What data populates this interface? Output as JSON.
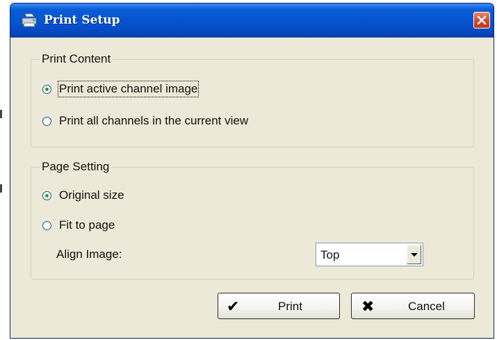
{
  "window": {
    "title": "Print Setup",
    "icon": "printer-icon",
    "close_icon": "close-icon"
  },
  "print_content": {
    "legend": "Print Content",
    "options": [
      {
        "label": "Print active channel image",
        "checked": true
      },
      {
        "label": "Print all channels in the current view",
        "checked": false
      }
    ]
  },
  "page_setting": {
    "legend": "Page Setting",
    "options": [
      {
        "label": "Original size",
        "checked": true
      },
      {
        "label": "Fit to page",
        "checked": false
      }
    ],
    "align_label": "Align Image:",
    "align_value": "Top"
  },
  "buttons": {
    "print": {
      "label": "Print",
      "icon": "checkmark-icon",
      "glyph": "✔"
    },
    "cancel": {
      "label": "Cancel",
      "icon": "cross-icon",
      "glyph": "✖"
    }
  },
  "colors": {
    "titlebar": "#0553d0",
    "dialog_bg": "#ece9d8",
    "close_button": "#d4482a",
    "radio_dot": "#21a121"
  }
}
